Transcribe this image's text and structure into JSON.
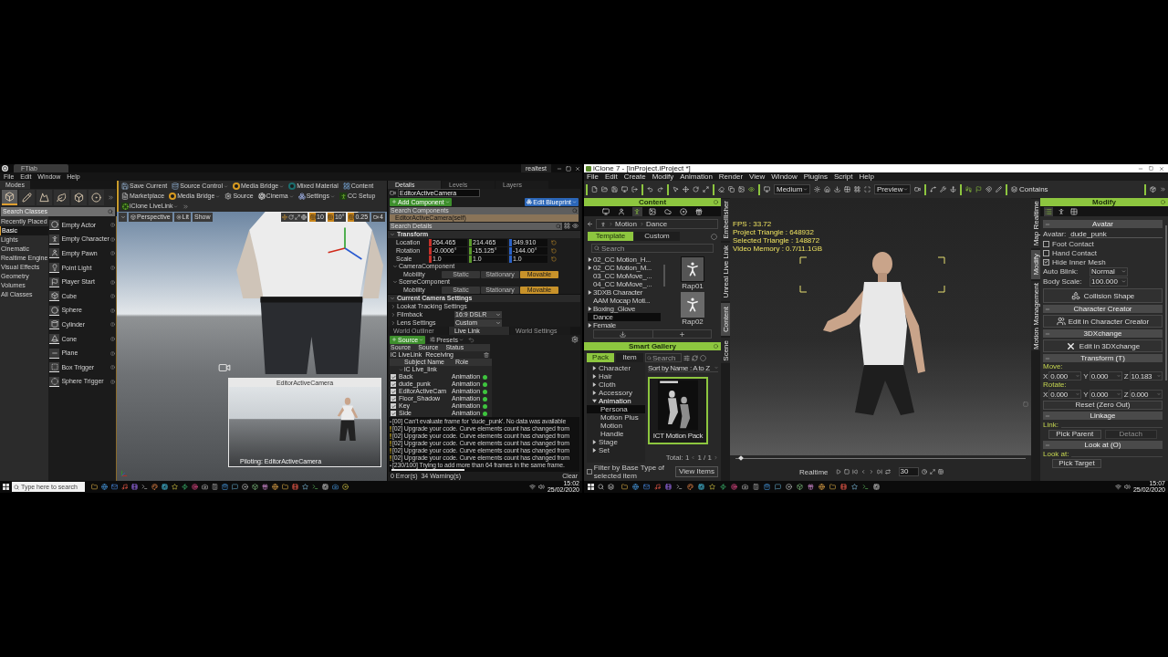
{
  "ue": {
    "window": {
      "tab": "FTlab",
      "project": "realtest"
    },
    "menu": [
      "File",
      "Edit",
      "Window",
      "Help"
    ],
    "modes": {
      "title": "Modes",
      "tabs": [
        {
          "selected": true
        },
        {
          "selected": false
        },
        {
          "selected": false
        },
        {
          "selected": false
        },
        {
          "selected": false
        },
        {
          "selected": false
        }
      ],
      "search": {
        "placeholder": "Search Classes"
      },
      "categories": [
        {
          "label": "Recently Placed",
          "selected": false
        },
        {
          "label": "Basic",
          "selected": true
        },
        {
          "label": "Lights",
          "selected": false
        },
        {
          "label": "Cinematic",
          "selected": false
        },
        {
          "label": "Realtime Engine",
          "selected": false
        },
        {
          "label": "Visual Effects",
          "selected": false
        },
        {
          "label": "Geometry",
          "selected": false
        },
        {
          "label": "Volumes",
          "selected": false
        },
        {
          "label": "All Classes",
          "selected": false
        }
      ],
      "items": [
        {
          "label": "Empty Actor",
          "kind": "sphere"
        },
        {
          "label": "Empty Character",
          "kind": "figure"
        },
        {
          "label": "Empty Pawn",
          "kind": "pawn"
        },
        {
          "label": "Point Light",
          "kind": "bulb"
        },
        {
          "label": "Player Start",
          "kind": "flag"
        },
        {
          "label": "Cube",
          "kind": "cube"
        },
        {
          "label": "Sphere",
          "kind": "sphere"
        },
        {
          "label": "Cylinder",
          "kind": "cylinder"
        },
        {
          "label": "Cone",
          "kind": "cone"
        },
        {
          "label": "Plane",
          "kind": "plane"
        },
        {
          "label": "Box Trigger",
          "kind": "box"
        },
        {
          "label": "Sphere Trigger",
          "kind": "ring"
        }
      ]
    },
    "toolbar": [
      {
        "label": "Save Current",
        "kind": "save",
        "menu": false
      },
      {
        "label": "Source Control",
        "kind": "source",
        "menu": true
      },
      {
        "label": "Media Bridge",
        "kind": "bridge",
        "menu": true
      },
      {
        "label": "Mixed Material",
        "kind": "material",
        "menu": false
      },
      {
        "label": "Content",
        "kind": "content",
        "menu": false
      },
      {
        "label": "Marketplace",
        "kind": "market",
        "menu": false
      },
      {
        "label": "Media Bridge",
        "kind": "bridge",
        "menu": true
      },
      {
        "label": "Source",
        "kind": "gear",
        "menu": false
      },
      {
        "label": "Cinema",
        "kind": "cine",
        "menu": true
      },
      {
        "label": "Settings",
        "kind": "settings",
        "menu": true
      },
      {
        "label": "CC Setup",
        "kind": "cc",
        "menu": false
      },
      {
        "label": "iClone LiveLink",
        "kind": "live",
        "menu": true
      }
    ],
    "viewport": {
      "view": "Perspective",
      "lighting": "Lit",
      "show": "Show",
      "snaps": [
        "10",
        "10°",
        "0.25"
      ],
      "camera_speed": "4",
      "preview": {
        "title": "EditorActiveCamera",
        "caption": "Piloting: EditorActiveCamera"
      }
    },
    "details": {
      "tabs": [
        {
          "label": "Details",
          "selected": true
        },
        {
          "label": "Levels",
          "selected": false
        },
        {
          "label": "Layers",
          "selected": false
        }
      ],
      "name": "EditorActiveCamera",
      "add_button": "Add Component",
      "blueprint_button": "Edit Blueprint",
      "search_components": {
        "placeholder": "Search Components"
      },
      "self_row": "EditorActiveCamera(self)",
      "search_details": {
        "placeholder": "Search Details"
      },
      "transform": {
        "title": "Transform",
        "rows": [
          {
            "label": "Location",
            "values": [
              "264.465",
              "214.465",
              "349.910"
            ]
          },
          {
            "label": "Rotation",
            "values": [
              "-0.0006°",
              "-15.125°",
              "-144.00°"
            ]
          },
          {
            "label": "Scale",
            "values": [
              "1.0",
              "1.0",
              "1.0"
            ]
          }
        ]
      },
      "components": [
        {
          "title": "CameraComponent",
          "label": "Mobility",
          "options": [
            {
              "label": "Static",
              "selected": false
            },
            {
              "label": "Stationary",
              "selected": false
            },
            {
              "label": "Movable",
              "selected": true
            }
          ]
        },
        {
          "title": "SceneComponent",
          "label": "Mobility",
          "options": [
            {
              "label": "Static",
              "selected": false
            },
            {
              "label": "Stationary",
              "selected": false
            },
            {
              "label": "Movable",
              "selected": true
            }
          ]
        }
      ],
      "camera_settings": {
        "title": "Current Camera Settings",
        "rows": [
          {
            "label": "Lookat Tracking Settings"
          },
          {
            "label": "Filmback",
            "value": "16:9 DSLR"
          },
          {
            "label": "Lens Settings",
            "value": "Custom"
          }
        ]
      }
    },
    "lower_tabs": [
      {
        "label": "World Outliner",
        "selected": false
      },
      {
        "label": "Live Link",
        "selected": true
      },
      {
        "label": "World Settings",
        "selected": false
      }
    ],
    "livelink": {
      "source_button": "Source",
      "presets_button": "Presets",
      "source_columns": [
        "Source",
        "Source",
        "Status"
      ],
      "sources": [
        {
          "type": "iC LiveLink",
          "status": "Receiving"
        }
      ],
      "subject_columns": [
        "Subject Name",
        "Role"
      ],
      "group": "iC Live_link",
      "subjects": [
        {
          "name": "Back",
          "role": "Animation",
          "checked": true
        },
        {
          "name": "dude_punk",
          "role": "Animation",
          "checked": true
        },
        {
          "name": "EditorActiveCam",
          "role": "Animation",
          "checked": true
        },
        {
          "name": "Floor_Shadow",
          "role": "Animation",
          "checked": true
        },
        {
          "name": "Key",
          "role": "Animation",
          "checked": true
        },
        {
          "name": "Side",
          "role": "Animation",
          "checked": true
        }
      ]
    },
    "log": {
      "lines": [
        {
          "kind": "info",
          "text": "[00] Can't evaluate frame for 'dude_punk'. No data was available"
        },
        {
          "kind": "warning",
          "text": "[02] Upgrade your code. Curve elements count has changed from"
        },
        {
          "kind": "warning",
          "text": "[02] Upgrade your code. Curve elements count has changed from"
        },
        {
          "kind": "warning",
          "text": "[02] Upgrade your code. Curve elements count has changed from"
        },
        {
          "kind": "warning",
          "text": "[02] Upgrade your code. Curve elements count has changed from"
        },
        {
          "kind": "warning",
          "text": "[02] Upgrade your code. Curve elements count has changed from"
        },
        {
          "kind": "info",
          "text": "[230/100] Trying to add more than 64 frames in the same frame."
        }
      ],
      "summary": "0 Error(s)  34 Warning(s)",
      "clear": "Clear"
    },
    "taskbar": {
      "search": {
        "placeholder": "Type here to search"
      },
      "time": "15:02",
      "date": "25/02/2020"
    }
  },
  "ic": {
    "window": {
      "title": "iClone 7 - [InProject.iProject *]"
    },
    "menu": [
      "File",
      "Edit",
      "Create",
      "Modify",
      "Animation",
      "Render",
      "View",
      "Window",
      "Plugins",
      "Script",
      "Help"
    ],
    "toolbar": {
      "quality": "Medium",
      "preview": "Preview",
      "combine": "Contains"
    },
    "content": {
      "title": "Content",
      "icon_tabs": [
        {
          "selected": false
        },
        {
          "selected": false
        },
        {
          "selected": true
        },
        {
          "selected": false
        },
        {
          "selected": false
        },
        {
          "selected": false
        },
        {
          "selected": false
        }
      ],
      "breadcrumb": [
        "Motion",
        "Dance"
      ],
      "tabs": [
        {
          "label": "Template",
          "selected": true
        },
        {
          "label": "Custom",
          "selected": false
        }
      ],
      "search": {
        "placeholder": "Search"
      },
      "tree": [
        {
          "label": "02_CC Motion_H...",
          "expandable": true,
          "selected": false
        },
        {
          "label": "02_CC Motion_M...",
          "expandable": true,
          "selected": false
        },
        {
          "label": "03_CC MoMove_...",
          "expandable": false,
          "selected": false
        },
        {
          "label": "04_CC MoMove_...",
          "expandable": false,
          "selected": false
        },
        {
          "label": "3DXB Character",
          "expandable": true,
          "selected": false
        },
        {
          "label": "AAM Mocap Moti...",
          "expandable": false,
          "selected": false
        },
        {
          "label": "Boxing_Glove",
          "expandable": true,
          "selected": false
        },
        {
          "label": "Dance",
          "expandable": false,
          "selected": true
        },
        {
          "label": "Female",
          "expandable": true,
          "selected": false
        }
      ],
      "thumbnails": [
        {
          "label": "Rap01",
          "selected": true
        },
        {
          "label": "Rap02",
          "selected": false
        }
      ]
    },
    "content_side_tabs": [
      {
        "label": "Embellisher",
        "selected": false
      },
      {
        "label": "Unreal Live Link",
        "selected": false
      },
      {
        "label": "Content",
        "selected": true
      },
      {
        "label": "Scene",
        "selected": false
      }
    ],
    "gallery": {
      "title": "Smart Gallery",
      "tabs": [
        {
          "label": "Pack",
          "selected": true
        },
        {
          "label": "Item",
          "selected": false
        }
      ],
      "search": {
        "placeholder": "Search"
      },
      "tree": [
        {
          "label": "Character",
          "expanded": false,
          "selected": false
        },
        {
          "label": "Hair",
          "expanded": false,
          "selected": false
        },
        {
          "label": "Cloth",
          "expanded": false,
          "selected": false
        },
        {
          "label": "Accessory",
          "expanded": false,
          "selected": false
        },
        {
          "label": "Animation",
          "expanded": true,
          "selected": false,
          "children": [
            {
              "label": "Persona",
              "selected": true
            },
            {
              "label": "Motion Plus",
              "selected": false
            },
            {
              "label": "Motion",
              "selected": false
            },
            {
              "label": "Handle",
              "selected": false
            }
          ]
        },
        {
          "label": "Stage",
          "expanded": false,
          "selected": false
        },
        {
          "label": "Set",
          "expanded": false,
          "selected": false
        }
      ],
      "sort": "Sort by Name : A to Z",
      "pack": "ICT Motion Pack",
      "total": "Total: 1",
      "pages": "1 / 1",
      "filter": {
        "label": "Filter by Base Type of selected item",
        "checked": false
      },
      "view_button": "View Items"
    },
    "viewport": {
      "stats": [
        "FPS : 33.72",
        "Project Triangle : 648932",
        "Selected Triangle : 148872",
        "Video Memory : 0.7/11.1GB"
      ]
    },
    "timeline": {
      "level": 0.02,
      "mode": "Realtime",
      "frame": "30"
    },
    "modify_side_tabs": [
      {
        "label": "Map Realtime",
        "selected": false
      },
      {
        "label": "Modify",
        "selected": true
      },
      {
        "label": "Motion Management",
        "selected": false
      }
    ],
    "modify": {
      "title": "Modify",
      "icon_tabs": [
        {
          "selected": true
        },
        {
          "selected": false
        },
        {
          "selected": false
        }
      ],
      "avatar": {
        "title": "Avatar",
        "label": "Avatar:",
        "value": "dude_punk",
        "checks": [
          {
            "label": "Foot Contact",
            "checked": false
          },
          {
            "label": "Hand Contact",
            "checked": false
          },
          {
            "label": "Hide Inner Mesh",
            "checked": true
          }
        ],
        "blink_label": "Auto Blink:",
        "blink": "Normal",
        "scale_label": "Body Scale:",
        "scale": "100.000",
        "collision": "Collision Shape"
      },
      "cc": {
        "title": "Character Creator",
        "button": "Edit in Character Creator"
      },
      "dx": {
        "title": "3DXchange",
        "button": "Edit in 3DXchange"
      },
      "transform": {
        "title": "Transform (T)",
        "groups": [
          {
            "label": "Move:",
            "values": [
              {
                "axis": "X",
                "value": "0.000"
              },
              {
                "axis": "Y",
                "value": "0.000"
              },
              {
                "axis": "Z",
                "value": "10.183"
              }
            ]
          },
          {
            "label": "Rotate:",
            "values": [
              {
                "axis": "X",
                "value": "0.000"
              },
              {
                "axis": "Y",
                "value": "0.000"
              },
              {
                "axis": "Z",
                "value": "0.000"
              }
            ]
          }
        ],
        "reset": "Reset (Zero Out)"
      },
      "linkage": {
        "title": "Linkage",
        "label": "Link:",
        "pick": "Pick Parent",
        "detach": {
          "label": "Detach",
          "disabled": true
        }
      },
      "lookat": {
        "title": "Look at (O)",
        "label": "Look at:",
        "pick": "Pick Target"
      }
    },
    "taskbar": {
      "time": "15:07",
      "date": "25/02/2020"
    }
  }
}
